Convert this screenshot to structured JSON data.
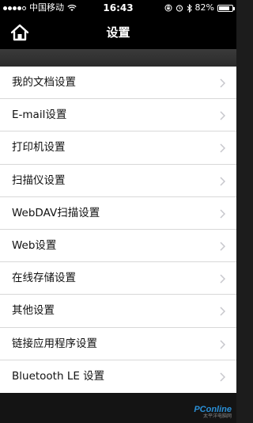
{
  "status_bar": {
    "carrier": "中国移动",
    "time": "16:43",
    "battery": "82%",
    "battery_level": 0.82,
    "signal_bars": 4,
    "icons": [
      "signal-icon",
      "wifi-icon",
      "lock-rotation-icon",
      "alarm-icon",
      "bluetooth-icon",
      "battery-icon"
    ]
  },
  "nav": {
    "title": "设置",
    "home_icon": "home-icon"
  },
  "settings": [
    {
      "label": "我的文档设置"
    },
    {
      "label": "E-mail设置"
    },
    {
      "label": "打印机设置"
    },
    {
      "label": "扫描仪设置"
    },
    {
      "label": "WebDAV扫描设置"
    },
    {
      "label": "Web设置"
    },
    {
      "label": "在线存储设置"
    },
    {
      "label": "其他设置"
    },
    {
      "label": "链接应用程序设置"
    },
    {
      "label": "Bluetooth LE 设置"
    }
  ],
  "watermark": {
    "brand": "PConline",
    "sub": "太平洋电脑网"
  },
  "colors": {
    "nav_background": "#000000",
    "list_background": "#ffffff",
    "chevron": "#c7c7cc",
    "watermark": "#2a8fd6"
  }
}
